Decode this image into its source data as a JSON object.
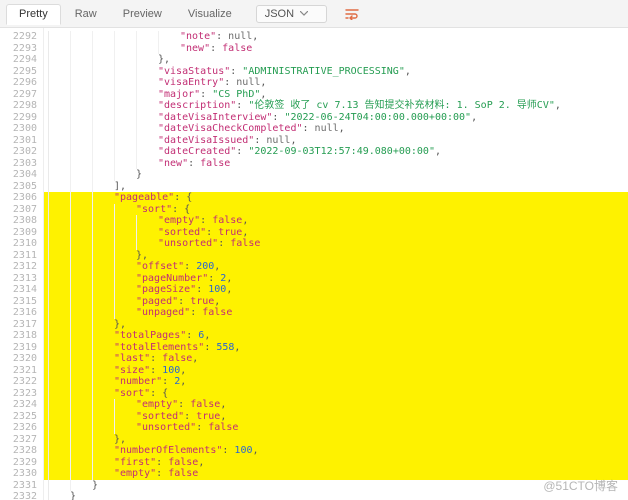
{
  "toolbar": {
    "tabs": [
      "Pretty",
      "Raw",
      "Preview",
      "Visualize"
    ],
    "selected_tab": "Pretty",
    "format_select": "JSON",
    "wrap_icon": "wrap-lines-icon"
  },
  "gutter": {
    "start": 2292,
    "end": 2332
  },
  "highlight": {
    "from": 2306,
    "to": 2330
  },
  "code_lines": [
    {
      "ln": 2292,
      "indent": 6,
      "tokens": [
        [
          "k",
          "\"note\""
        ],
        [
          "p",
          ": "
        ],
        [
          "nl",
          "null"
        ],
        [
          "p",
          ","
        ]
      ]
    },
    {
      "ln": 2293,
      "indent": 6,
      "tokens": [
        [
          "k",
          "\"new\""
        ],
        [
          "p",
          ": "
        ],
        [
          "b",
          "false"
        ]
      ]
    },
    {
      "ln": 2294,
      "indent": 5,
      "tokens": [
        [
          "p",
          "},"
        ]
      ]
    },
    {
      "ln": 2295,
      "indent": 5,
      "tokens": [
        [
          "k",
          "\"visaStatus\""
        ],
        [
          "p",
          ": "
        ],
        [
          "s",
          "\"ADMINISTRATIVE_PROCESSING\""
        ],
        [
          "p",
          ","
        ]
      ]
    },
    {
      "ln": 2296,
      "indent": 5,
      "tokens": [
        [
          "k",
          "\"visaEntry\""
        ],
        [
          "p",
          ": "
        ],
        [
          "nl",
          "null"
        ],
        [
          "p",
          ","
        ]
      ]
    },
    {
      "ln": 2297,
      "indent": 5,
      "tokens": [
        [
          "k",
          "\"major\""
        ],
        [
          "p",
          ": "
        ],
        [
          "s",
          "\"CS PhD\""
        ],
        [
          "p",
          ","
        ]
      ]
    },
    {
      "ln": 2298,
      "indent": 5,
      "tokens": [
        [
          "k",
          "\"description\""
        ],
        [
          "p",
          ": "
        ],
        [
          "s",
          "\"伦敦签 收了 cv 7.13 告知提交补充材料: 1. SoP 2. 导师CV\""
        ],
        [
          "p",
          ","
        ]
      ]
    },
    {
      "ln": 2299,
      "indent": 5,
      "tokens": [
        [
          "k",
          "\"dateVisaInterview\""
        ],
        [
          "p",
          ": "
        ],
        [
          "s",
          "\"2022-06-24T04:00:00.000+00:00\""
        ],
        [
          "p",
          ","
        ]
      ]
    },
    {
      "ln": 2300,
      "indent": 5,
      "tokens": [
        [
          "k",
          "\"dateVisaCheckCompleted\""
        ],
        [
          "p",
          ": "
        ],
        [
          "nl",
          "null"
        ],
        [
          "p",
          ","
        ]
      ]
    },
    {
      "ln": 2301,
      "indent": 5,
      "tokens": [
        [
          "k",
          "\"dateVisaIssued\""
        ],
        [
          "p",
          ": "
        ],
        [
          "nl",
          "null"
        ],
        [
          "p",
          ","
        ]
      ]
    },
    {
      "ln": 2302,
      "indent": 5,
      "tokens": [
        [
          "k",
          "\"dateCreated\""
        ],
        [
          "p",
          ": "
        ],
        [
          "s",
          "\"2022-09-03T12:57:49.080+00:00\""
        ],
        [
          "p",
          ","
        ]
      ]
    },
    {
      "ln": 2303,
      "indent": 5,
      "tokens": [
        [
          "k",
          "\"new\""
        ],
        [
          "p",
          ": "
        ],
        [
          "b",
          "false"
        ]
      ]
    },
    {
      "ln": 2304,
      "indent": 4,
      "tokens": [
        [
          "p",
          "}"
        ]
      ]
    },
    {
      "ln": 2305,
      "indent": 3,
      "tokens": [
        [
          "p",
          "],"
        ]
      ]
    },
    {
      "ln": 2306,
      "indent": 3,
      "tokens": [
        [
          "k",
          "\"pageable\""
        ],
        [
          "p",
          ": {"
        ]
      ]
    },
    {
      "ln": 2307,
      "indent": 4,
      "tokens": [
        [
          "k",
          "\"sort\""
        ],
        [
          "p",
          ": {"
        ]
      ]
    },
    {
      "ln": 2308,
      "indent": 5,
      "tokens": [
        [
          "k",
          "\"empty\""
        ],
        [
          "p",
          ": "
        ],
        [
          "b",
          "false"
        ],
        [
          "p",
          ","
        ]
      ]
    },
    {
      "ln": 2309,
      "indent": 5,
      "tokens": [
        [
          "k",
          "\"sorted\""
        ],
        [
          "p",
          ": "
        ],
        [
          "b",
          "true"
        ],
        [
          "p",
          ","
        ]
      ]
    },
    {
      "ln": 2310,
      "indent": 5,
      "tokens": [
        [
          "k",
          "\"unsorted\""
        ],
        [
          "p",
          ": "
        ],
        [
          "b",
          "false"
        ]
      ]
    },
    {
      "ln": 2311,
      "indent": 4,
      "tokens": [
        [
          "p",
          "},"
        ]
      ]
    },
    {
      "ln": 2312,
      "indent": 4,
      "tokens": [
        [
          "k",
          "\"offset\""
        ],
        [
          "p",
          ": "
        ],
        [
          "n",
          "200"
        ],
        [
          "p",
          ","
        ]
      ]
    },
    {
      "ln": 2313,
      "indent": 4,
      "tokens": [
        [
          "k",
          "\"pageNumber\""
        ],
        [
          "p",
          ": "
        ],
        [
          "n",
          "2"
        ],
        [
          "p",
          ","
        ]
      ]
    },
    {
      "ln": 2314,
      "indent": 4,
      "tokens": [
        [
          "k",
          "\"pageSize\""
        ],
        [
          "p",
          ": "
        ],
        [
          "n",
          "100"
        ],
        [
          "p",
          ","
        ]
      ]
    },
    {
      "ln": 2315,
      "indent": 4,
      "tokens": [
        [
          "k",
          "\"paged\""
        ],
        [
          "p",
          ": "
        ],
        [
          "b",
          "true"
        ],
        [
          "p",
          ","
        ]
      ]
    },
    {
      "ln": 2316,
      "indent": 4,
      "tokens": [
        [
          "k",
          "\"unpaged\""
        ],
        [
          "p",
          ": "
        ],
        [
          "b",
          "false"
        ]
      ]
    },
    {
      "ln": 2317,
      "indent": 3,
      "tokens": [
        [
          "p",
          "},"
        ]
      ]
    },
    {
      "ln": 2318,
      "indent": 3,
      "tokens": [
        [
          "k",
          "\"totalPages\""
        ],
        [
          "p",
          ": "
        ],
        [
          "n",
          "6"
        ],
        [
          "p",
          ","
        ]
      ]
    },
    {
      "ln": 2319,
      "indent": 3,
      "tokens": [
        [
          "k",
          "\"totalElements\""
        ],
        [
          "p",
          ": "
        ],
        [
          "n",
          "558"
        ],
        [
          "p",
          ","
        ]
      ]
    },
    {
      "ln": 2320,
      "indent": 3,
      "tokens": [
        [
          "k",
          "\"last\""
        ],
        [
          "p",
          ": "
        ],
        [
          "b",
          "false"
        ],
        [
          "p",
          ","
        ]
      ]
    },
    {
      "ln": 2321,
      "indent": 3,
      "tokens": [
        [
          "k",
          "\"size\""
        ],
        [
          "p",
          ": "
        ],
        [
          "n",
          "100"
        ],
        [
          "p",
          ","
        ]
      ]
    },
    {
      "ln": 2322,
      "indent": 3,
      "tokens": [
        [
          "k",
          "\"number\""
        ],
        [
          "p",
          ": "
        ],
        [
          "n",
          "2"
        ],
        [
          "p",
          ","
        ]
      ]
    },
    {
      "ln": 2323,
      "indent": 3,
      "tokens": [
        [
          "k",
          "\"sort\""
        ],
        [
          "p",
          ": {"
        ]
      ]
    },
    {
      "ln": 2324,
      "indent": 4,
      "tokens": [
        [
          "k",
          "\"empty\""
        ],
        [
          "p",
          ": "
        ],
        [
          "b",
          "false"
        ],
        [
          "p",
          ","
        ]
      ]
    },
    {
      "ln": 2325,
      "indent": 4,
      "tokens": [
        [
          "k",
          "\"sorted\""
        ],
        [
          "p",
          ": "
        ],
        [
          "b",
          "true"
        ],
        [
          "p",
          ","
        ]
      ]
    },
    {
      "ln": 2326,
      "indent": 4,
      "tokens": [
        [
          "k",
          "\"unsorted\""
        ],
        [
          "p",
          ": "
        ],
        [
          "b",
          "false"
        ]
      ]
    },
    {
      "ln": 2327,
      "indent": 3,
      "tokens": [
        [
          "p",
          "},"
        ]
      ]
    },
    {
      "ln": 2328,
      "indent": 3,
      "tokens": [
        [
          "k",
          "\"numberOfElements\""
        ],
        [
          "p",
          ": "
        ],
        [
          "n",
          "100"
        ],
        [
          "p",
          ","
        ]
      ]
    },
    {
      "ln": 2329,
      "indent": 3,
      "tokens": [
        [
          "k",
          "\"first\""
        ],
        [
          "p",
          ": "
        ],
        [
          "b",
          "false"
        ],
        [
          "p",
          ","
        ]
      ]
    },
    {
      "ln": 2330,
      "indent": 3,
      "tokens": [
        [
          "k",
          "\"empty\""
        ],
        [
          "p",
          ": "
        ],
        [
          "b",
          "false"
        ]
      ]
    },
    {
      "ln": 2331,
      "indent": 2,
      "tokens": [
        [
          "p",
          "}"
        ]
      ]
    },
    {
      "ln": 2332,
      "indent": 1,
      "tokens": [
        [
          "p",
          "}"
        ]
      ]
    }
  ],
  "watermark": "@51CTO博客"
}
